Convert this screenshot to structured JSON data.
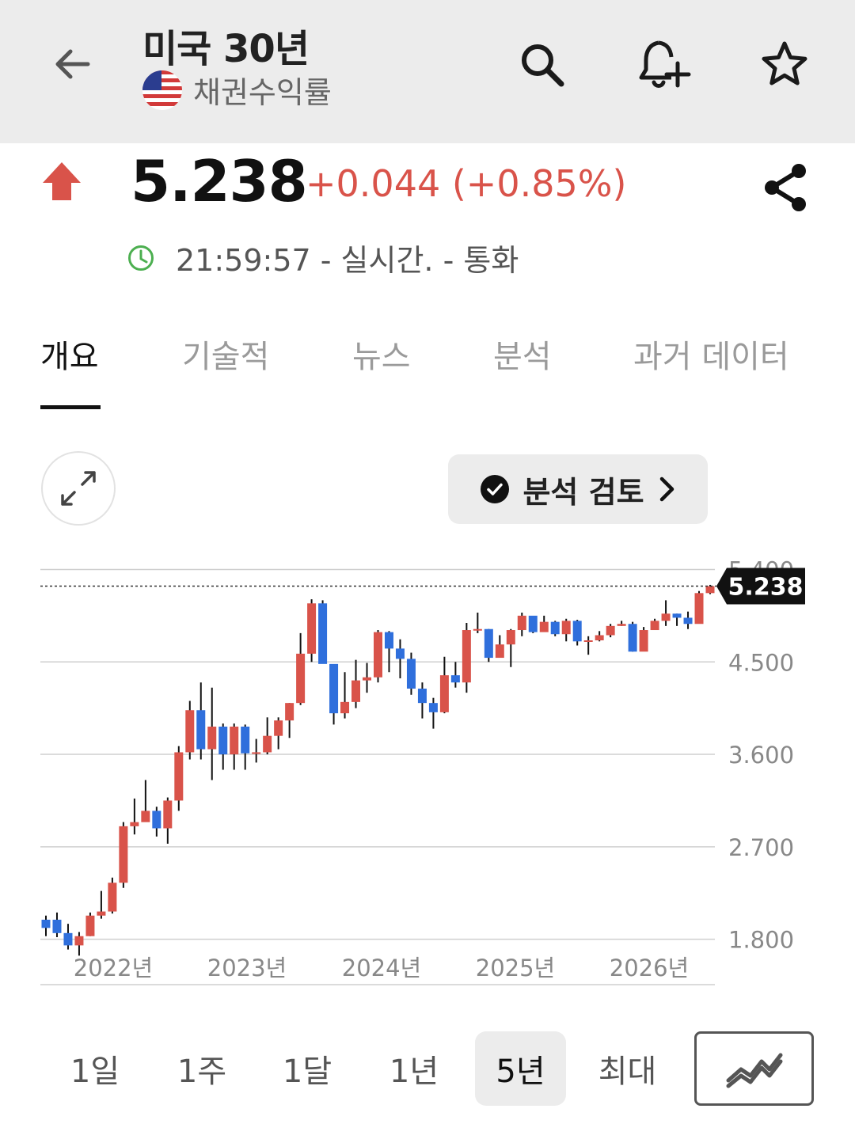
{
  "header": {
    "title": "미국 30년",
    "subtitle": "채권수익률",
    "flag_icon": "us-flag-icon",
    "icons": [
      "arrow-left-icon",
      "search-icon",
      "bell-plus-icon",
      "star-icon"
    ]
  },
  "quote": {
    "price": "5.238",
    "change": "+0.044 (+0.85%)",
    "time_status": "21:59:57 - 실시간. - 통화",
    "up_color": "#d9534a"
  },
  "tabs": [
    "개요",
    "기술적",
    "뉴스",
    "분석",
    "과거 데이터"
  ],
  "review_button": {
    "label": "분석 검토"
  },
  "periods": [
    "1일",
    "1주",
    "1달",
    "1년",
    "5년",
    "최대"
  ],
  "active_period": "5년",
  "chart_data": {
    "type": "candlestick",
    "y_ticks": [
      "5.400",
      "4.500",
      "3.600",
      "2.700",
      "1.800"
    ],
    "x_ticks": [
      "2022년",
      "2023년",
      "2024년",
      "2025년",
      "2026년"
    ],
    "current_value_label": "5.238",
    "ylim": [
      1.35,
      5.55
    ],
    "axis_position": "right",
    "grid": "horizontal",
    "up_color": "#d9534a",
    "down_color": "#2f6fdc",
    "current_value": 5.238,
    "candles": [
      [
        1.99,
        1.91,
        2.03,
        1.83
      ],
      [
        1.99,
        1.86,
        2.06,
        1.82
      ],
      [
        1.86,
        1.74,
        1.95,
        1.7
      ],
      [
        1.74,
        1.83,
        1.87,
        1.64
      ],
      [
        1.83,
        2.03,
        2.06,
        1.83
      ],
      [
        2.03,
        2.07,
        2.27,
        2.0
      ],
      [
        2.07,
        2.35,
        2.4,
        2.05
      ],
      [
        2.35,
        2.9,
        2.94,
        2.3
      ],
      [
        2.9,
        2.94,
        3.17,
        2.82
      ],
      [
        2.94,
        3.05,
        3.35,
        3.0
      ],
      [
        3.05,
        2.88,
        3.09,
        2.8
      ],
      [
        2.88,
        3.15,
        3.18,
        2.73
      ],
      [
        3.15,
        3.62,
        3.68,
        3.05
      ],
      [
        3.62,
        4.03,
        4.12,
        3.55
      ],
      [
        4.03,
        3.65,
        4.3,
        3.55
      ],
      [
        3.65,
        3.87,
        4.25,
        3.35
      ],
      [
        3.87,
        3.6,
        3.9,
        3.45
      ],
      [
        3.6,
        3.87,
        3.9,
        3.45
      ],
      [
        3.87,
        3.61,
        3.89,
        3.45
      ],
      [
        3.61,
        3.62,
        3.75,
        3.52
      ],
      [
        3.62,
        3.78,
        3.96,
        3.6
      ],
      [
        3.78,
        3.93,
        3.96,
        3.65
      ],
      [
        3.93,
        4.1,
        4.1,
        3.76
      ],
      [
        4.1,
        4.58,
        4.78,
        4.08
      ],
      [
        4.58,
        5.07,
        5.11,
        4.5
      ],
      [
        5.07,
        4.48,
        5.1,
        4.5
      ],
      [
        4.48,
        4.0,
        4.4,
        3.89
      ],
      [
        4.0,
        4.11,
        4.4,
        3.95
      ],
      [
        4.11,
        4.32,
        4.52,
        4.05
      ],
      [
        4.32,
        4.35,
        4.49,
        4.2
      ],
      [
        4.35,
        4.79,
        4.81,
        4.3
      ],
      [
        4.79,
        4.63,
        4.8,
        4.4
      ],
      [
        4.63,
        4.53,
        4.72,
        4.34
      ],
      [
        4.53,
        4.24,
        4.59,
        4.18
      ],
      [
        4.24,
        4.1,
        4.3,
        3.95
      ],
      [
        4.1,
        4.01,
        4.15,
        3.85
      ],
      [
        4.01,
        4.37,
        4.55,
        4.0
      ],
      [
        4.37,
        4.3,
        4.5,
        4.25
      ],
      [
        4.3,
        4.81,
        4.88,
        4.2
      ],
      [
        4.81,
        4.82,
        4.98,
        4.78
      ],
      [
        4.82,
        4.54,
        4.82,
        4.5
      ],
      [
        4.54,
        4.67,
        4.76,
        4.58
      ],
      [
        4.67,
        4.81,
        4.82,
        4.45
      ],
      [
        4.81,
        4.95,
        4.98,
        4.75
      ],
      [
        4.95,
        4.79,
        4.91,
        4.78
      ],
      [
        4.79,
        4.89,
        4.95,
        4.81
      ],
      [
        4.89,
        4.77,
        4.9,
        4.75
      ],
      [
        4.77,
        4.9,
        4.92,
        4.7
      ],
      [
        4.9,
        4.7,
        4.91,
        4.66
      ],
      [
        4.7,
        4.71,
        4.75,
        4.57
      ],
      [
        4.71,
        4.76,
        4.8,
        4.7
      ],
      [
        4.76,
        4.85,
        4.87,
        4.74
      ],
      [
        4.85,
        4.87,
        4.9,
        4.85
      ],
      [
        4.87,
        4.6,
        4.89,
        4.6
      ],
      [
        4.6,
        4.81,
        4.84,
        4.66
      ],
      [
        4.81,
        4.9,
        4.92,
        4.85
      ],
      [
        4.9,
        4.97,
        5.1,
        4.85
      ],
      [
        4.97,
        4.93,
        4.97,
        4.85
      ],
      [
        4.93,
        4.87,
        4.99,
        4.82
      ],
      [
        4.87,
        5.17,
        5.19,
        5.0
      ],
      [
        5.17,
        5.238,
        5.25,
        5.16
      ]
    ]
  }
}
